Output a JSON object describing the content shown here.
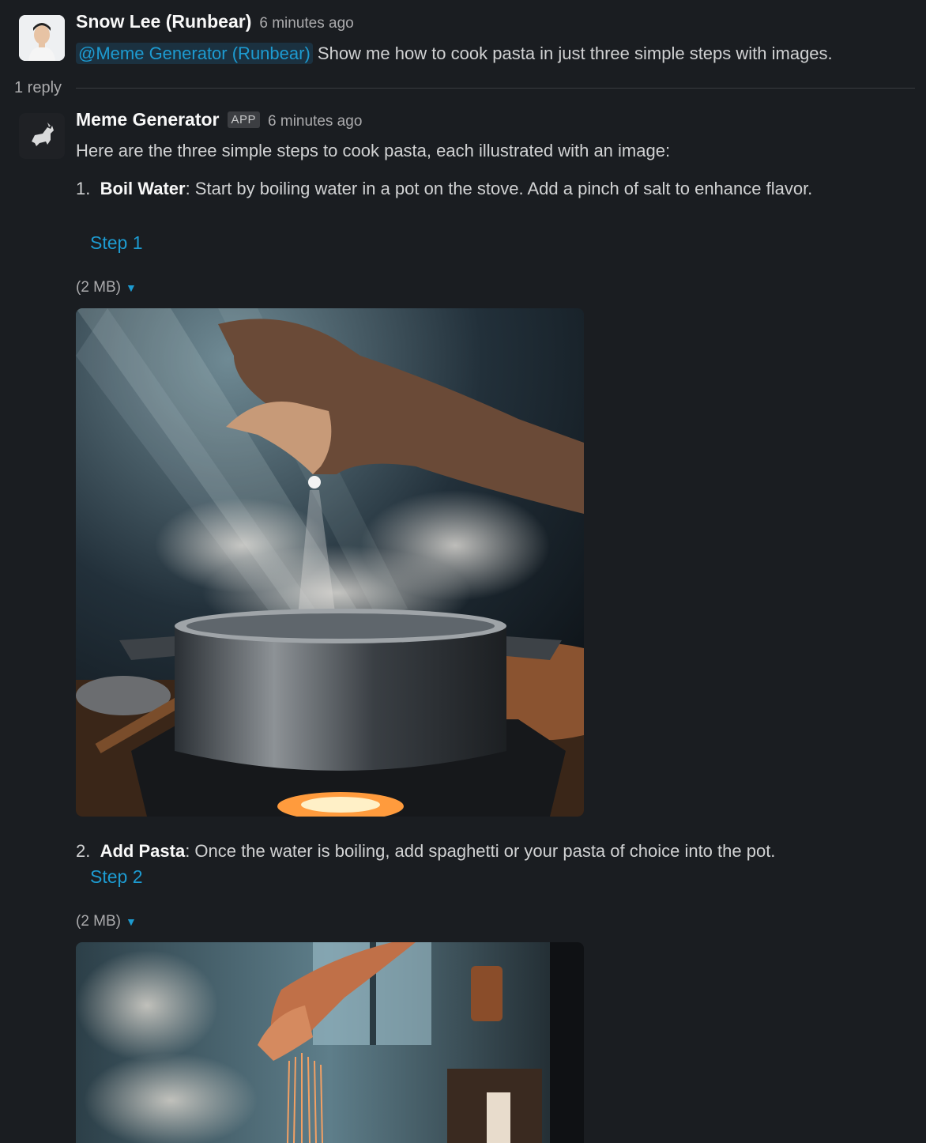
{
  "messages": {
    "user": {
      "name": "Snow Lee (Runbear)",
      "time": "6 minutes ago",
      "mention": "@Meme Generator (Runbear)",
      "text": "Show me how to cook pasta in just three simple steps with images."
    },
    "reply_count": "1 reply",
    "bot": {
      "name": "Meme Generator",
      "badge": "APP",
      "time": "6 minutes ago",
      "intro": "Here are the three simple steps to cook pasta, each illustrated with an image:"
    }
  },
  "steps": [
    {
      "number": "1.",
      "title": "Boil Water",
      "text": ": Start by boiling water in a pot on the stove. Add a pinch of salt to enhance flavor.",
      "link": "Step 1",
      "file_size": "(2 MB)"
    },
    {
      "number": "2.",
      "title": "Add Pasta",
      "text": ": Once the water is boiling, add spaghetti or your pasta of choice into the pot.",
      "link": "Step 2",
      "file_size": "(2 MB)"
    }
  ],
  "colors": {
    "background": "#1a1d21",
    "link": "#1d9bd1",
    "text": "#d1d2d3",
    "muted": "#ababad"
  }
}
